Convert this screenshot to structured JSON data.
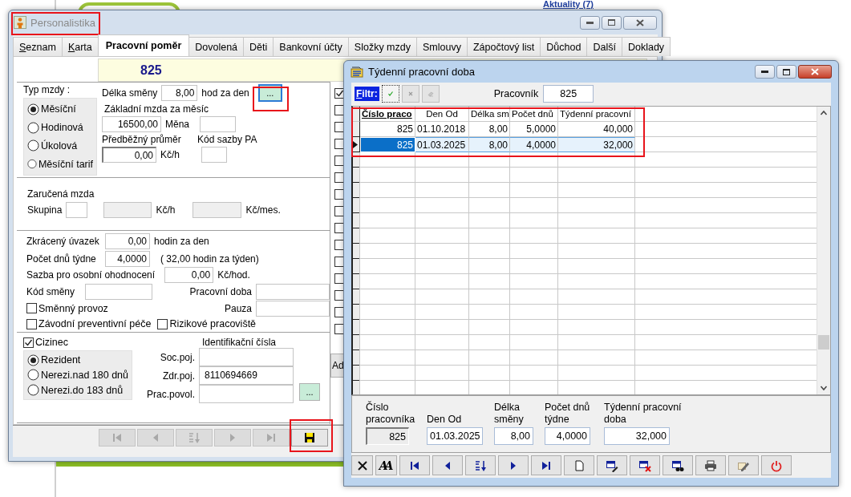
{
  "desktop": {
    "link": "Aktuality (7)"
  },
  "main_window": {
    "title": "Personalistika",
    "active": false,
    "tabs": [
      {
        "label": "Seznam",
        "selected": false,
        "hotkey": true
      },
      {
        "label": "Karta",
        "selected": false,
        "hotkey": true
      },
      {
        "label": "Pracovní poměr",
        "selected": true,
        "hotkey": false
      },
      {
        "label": "Dovolená",
        "selected": false,
        "hotkey": false
      },
      {
        "label": "Děti",
        "selected": false,
        "hotkey": false
      },
      {
        "label": "Bankovní účty",
        "selected": false,
        "hotkey": false
      },
      {
        "label": "Složky mzdy",
        "selected": false,
        "hotkey": false
      },
      {
        "label": "Smlouvy",
        "selected": false,
        "hotkey": false
      },
      {
        "label": "Zápočtový list",
        "selected": false,
        "hotkey": false
      },
      {
        "label": "Důchod",
        "selected": false,
        "hotkey": false
      },
      {
        "label": "Další",
        "selected": false,
        "hotkey": false
      },
      {
        "label": "Doklady",
        "selected": false,
        "hotkey": false
      }
    ],
    "employee_number": "825",
    "wage_type": {
      "label": "Typ mzdy :",
      "options": [
        {
          "label": "Měsíční",
          "selected": true
        },
        {
          "label": "Hodinová",
          "selected": false
        },
        {
          "label": "Úkolová",
          "selected": false
        },
        {
          "label": "Měsíční tarif",
          "selected": false
        }
      ]
    },
    "shift_length": {
      "label": "Délka směny",
      "value": "8,00",
      "unit": "hod za den",
      "button": "..."
    },
    "base_wage": {
      "label": "Základní mzda za měsíc",
      "value": "16500,00"
    },
    "currency": {
      "label": "Měna"
    },
    "average": {
      "label": "Předběžný průměr",
      "value": "0,00",
      "unit": "Kč/h"
    },
    "rate_code": {
      "label": "Kód sazby PA"
    },
    "guaranteed_wage": {
      "label": "Zaručená mzda",
      "group_label": "Skupina",
      "hourly_unit": "Kč/h",
      "monthly_unit": "Kč/mes."
    },
    "reduced_hours": {
      "label": "Zkrácený úvazek",
      "value": "0,00",
      "unit": "hodin za den"
    },
    "days_per_week": {
      "label": "Počet dnů týdne",
      "value": "4,0000",
      "note": "( 32,00 hodin za týden)"
    },
    "personal_rate": {
      "label": "Sazba pro osobní ohodnocení",
      "value": "0,00",
      "unit": "Kč/hod."
    },
    "shift_code": {
      "label": "Kód směny"
    },
    "working_time": {
      "label": "Pracovní doba"
    },
    "pause": {
      "label": "Pauza"
    },
    "flags": [
      {
        "label": "Směnný provoz",
        "checked": false
      },
      {
        "label": "Závodní preventivní péče",
        "checked": false
      },
      {
        "label": "Rizikové pracoviště",
        "checked": false
      }
    ],
    "foreigner": {
      "label": "Cizinec",
      "checked": true,
      "options": [
        {
          "label": "Rezident",
          "selected": true
        },
        {
          "label": "Nerezi.nad 180 dnů",
          "selected": false
        },
        {
          "label": "Nerezi.do 183 dnů",
          "selected": false
        }
      ]
    },
    "ids": {
      "title": "Identifikační čísla",
      "fields": [
        {
          "label": "Soc.poj."
        },
        {
          "label": "Zdr.poj.",
          "value": "8110694669"
        },
        {
          "label": "Prac.povol."
        }
      ],
      "button": "..."
    },
    "side_checkboxes": [
      {
        "checked": true
      },
      {
        "checked": false
      },
      {
        "checked": false
      },
      {
        "checked": false
      },
      {
        "checked": false
      },
      {
        "checked": false
      },
      {
        "checked": false
      },
      {
        "checked": false
      },
      {
        "checked": false
      },
      {
        "checked": false
      },
      {
        "checked": false
      },
      {
        "checked": false
      },
      {
        "checked": false
      },
      {
        "checked": false
      },
      {
        "checked": false
      }
    ],
    "side_button": "Ad",
    "nav_buttons": [
      {
        "kind": "first",
        "disabled": true
      },
      {
        "kind": "prev",
        "disabled": true
      },
      {
        "kind": "sort",
        "disabled": true
      },
      {
        "kind": "next",
        "disabled": true
      },
      {
        "kind": "last",
        "disabled": true
      },
      {
        "kind": "save",
        "disabled": false
      }
    ]
  },
  "grid_window": {
    "title": "Týdenní pracovní doba",
    "active": true,
    "filter": {
      "label": "Filtr:",
      "hotkey": true,
      "buttons": [
        {
          "kind": "apply",
          "disabled": false
        },
        {
          "kind": "clear",
          "disabled": true
        },
        {
          "kind": "erase",
          "disabled": true
        }
      ]
    },
    "employee": {
      "label": "Pracovník",
      "value": "825"
    },
    "table": {
      "columns": [
        {
          "label": "Číslo praco",
          "sorted": true
        },
        {
          "label": "Den Od",
          "sorted": false
        },
        {
          "label": "Délka sm",
          "sorted": false
        },
        {
          "label": "Počet dnů",
          "sorted": false
        },
        {
          "label": "Týdenní pracovní",
          "sorted": false
        }
      ],
      "rows": [
        {
          "cells": [
            "825",
            "01.10.2018",
            "8,00",
            "5,0000",
            "40,000"
          ],
          "selected": false
        },
        {
          "cells": [
            "825",
            "01.03.2025",
            "8,00",
            "4,0000",
            "32,000"
          ],
          "selected": true
        }
      ]
    },
    "detail": [
      {
        "label": "Číslo pracovníka",
        "value": "825",
        "readonly": true
      },
      {
        "label": "Den Od",
        "value": "01.03.2025",
        "readonly": false
      },
      {
        "label": "Délka směny",
        "value": "8,00",
        "readonly": false
      },
      {
        "label": "Počet dnů týdne",
        "value": "4,0000",
        "readonly": false
      },
      {
        "label": "Týdenní pracovní doba",
        "value": "32,000",
        "readonly": false
      }
    ],
    "toolbar": [
      {
        "kind": "cancel"
      },
      {
        "kind": "font",
        "text": "AA"
      },
      {
        "kind": "first"
      },
      {
        "kind": "prev"
      },
      {
        "kind": "sort"
      },
      {
        "kind": "next"
      },
      {
        "kind": "last"
      },
      {
        "kind": "new"
      },
      {
        "kind": "edit"
      },
      {
        "kind": "delete"
      },
      {
        "kind": "find"
      },
      {
        "kind": "print"
      },
      {
        "kind": "tool"
      },
      {
        "kind": "power"
      }
    ]
  }
}
